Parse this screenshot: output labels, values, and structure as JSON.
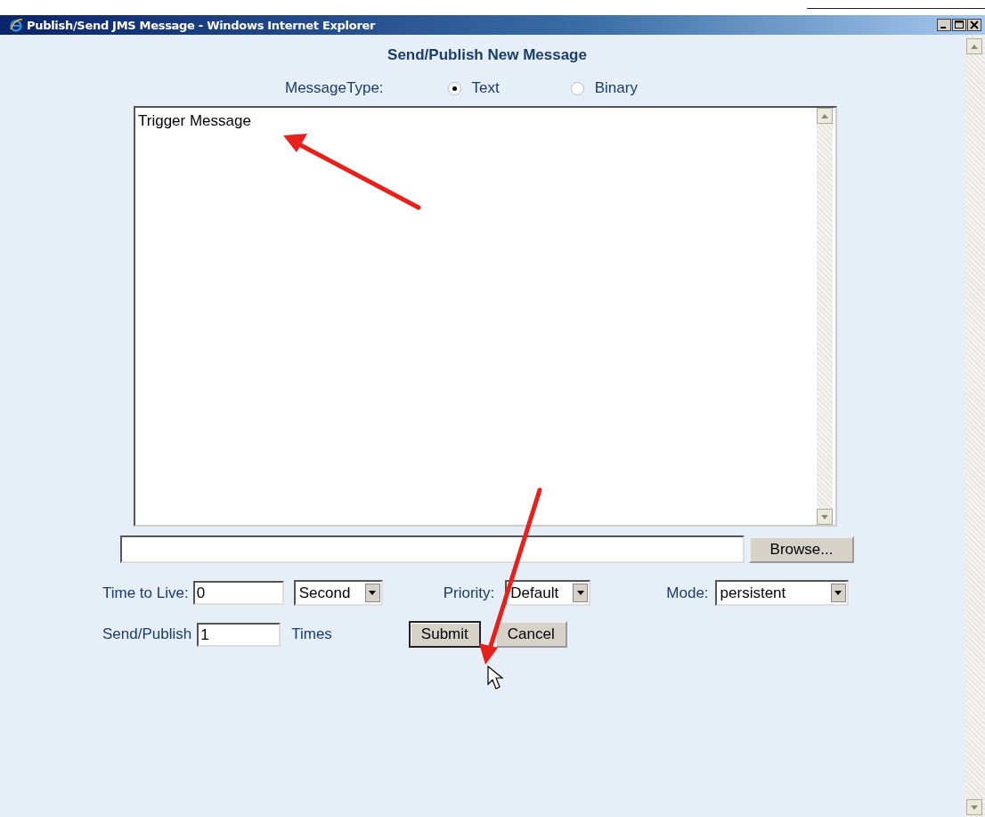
{
  "window": {
    "title": "Publish/Send JMS Message - Windows Internet Explorer"
  },
  "heading": "Send/Publish New Message",
  "message_type": {
    "label": "MessageType:",
    "options": [
      {
        "label": "Text",
        "selected": true
      },
      {
        "label": "Binary",
        "selected": false
      }
    ]
  },
  "message": {
    "value": "Trigger Message"
  },
  "file": {
    "button": "Browse..."
  },
  "time_to_live": {
    "label": "Time to Live:",
    "value": "0",
    "unit": "Second"
  },
  "priority": {
    "label": "Priority:",
    "value": "Default"
  },
  "mode": {
    "label": "Mode:",
    "value": "persistent"
  },
  "repeat": {
    "label": "Send/Publish",
    "value": "1",
    "suffix": "Times"
  },
  "buttons": [
    {
      "label": "Submit",
      "focused": true
    },
    {
      "label": "Cancel",
      "focused": false
    }
  ]
}
